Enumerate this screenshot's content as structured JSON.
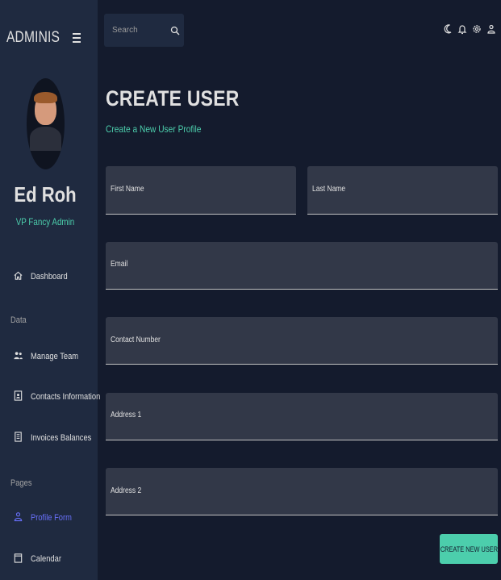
{
  "sidebar": {
    "brand": "ADMINIS",
    "profile": {
      "name": "Ed Roh",
      "role": "VP Fancy Admin"
    },
    "dashboard_label": "Dashboard",
    "section_data": "Data",
    "section_pages": "Pages",
    "items": [
      {
        "label": "Manage Team",
        "icon": "people-icon"
      },
      {
        "label": "Contacts Information",
        "icon": "contacts-icon"
      },
      {
        "label": "Invoices Balances",
        "icon": "receipt-icon"
      },
      {
        "label": "Profile Form",
        "icon": "person-icon",
        "active": true
      },
      {
        "label": "Calendar",
        "icon": "calendar-icon"
      }
    ]
  },
  "topbar": {
    "search_placeholder": "Search",
    "icons": [
      "dark-mode-icon",
      "notifications-icon",
      "settings-icon",
      "user-icon"
    ]
  },
  "header": {
    "title": "CREATE USER",
    "subtitle": "Create a New User Profile"
  },
  "form": {
    "first_name": {
      "label": "First Name",
      "value": ""
    },
    "last_name": {
      "label": "Last Name",
      "value": ""
    },
    "email": {
      "label": "Email",
      "value": ""
    },
    "contact": {
      "label": "Contact Number",
      "value": ""
    },
    "address1": {
      "label": "Address 1",
      "value": ""
    },
    "address2": {
      "label": "Address 2",
      "value": ""
    },
    "submit_label": "CREATE NEW USER"
  },
  "colors": {
    "background": "#141b2d",
    "sidebar": "#1f2a40",
    "accent_green": "#4cceac",
    "accent_purple": "#6870fa",
    "field_bg": "#323848"
  }
}
